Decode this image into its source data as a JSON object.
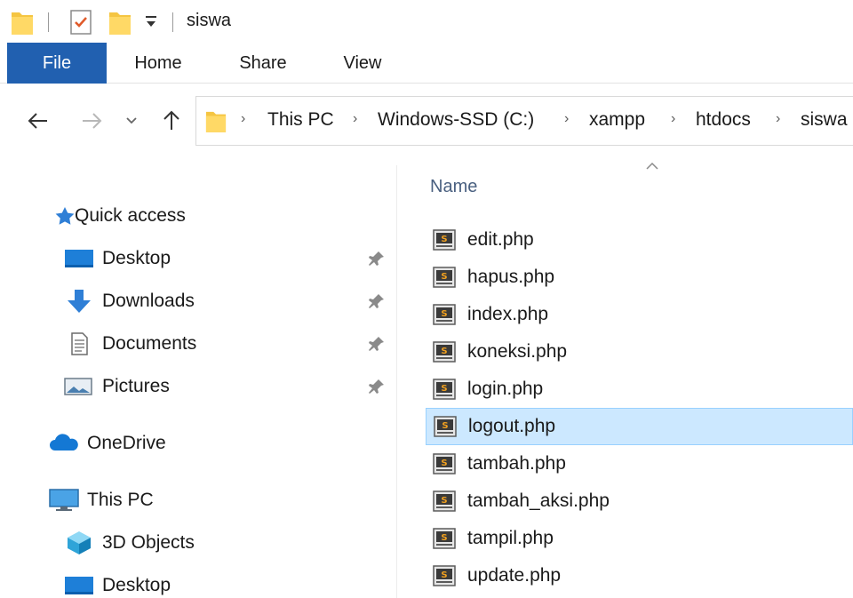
{
  "window": {
    "title": "siswa"
  },
  "ribbon": {
    "tabs": [
      "File",
      "Home",
      "Share",
      "View"
    ]
  },
  "address": {
    "crumbs": [
      "This PC",
      "Windows-SSD (C:)",
      "xampp",
      "htdocs",
      "siswa"
    ]
  },
  "navigation": {
    "quick_access": "Quick access",
    "pinned": [
      "Desktop",
      "Downloads",
      "Documents",
      "Pictures"
    ],
    "onedrive": "OneDrive",
    "this_pc": "This PC",
    "this_pc_items": [
      "3D Objects",
      "Desktop"
    ]
  },
  "file_list": {
    "column_name": "Name",
    "files": [
      "edit.php",
      "hapus.php",
      "index.php",
      "koneksi.php",
      "login.php",
      "logout.php",
      "tambah.php",
      "tambah_aksi.php",
      "tampil.php",
      "update.php"
    ],
    "selected": "logout.php"
  },
  "colors": {
    "accent": "#2160b0",
    "selection": "#cce8ff",
    "selection_border": "#99d1ff"
  }
}
